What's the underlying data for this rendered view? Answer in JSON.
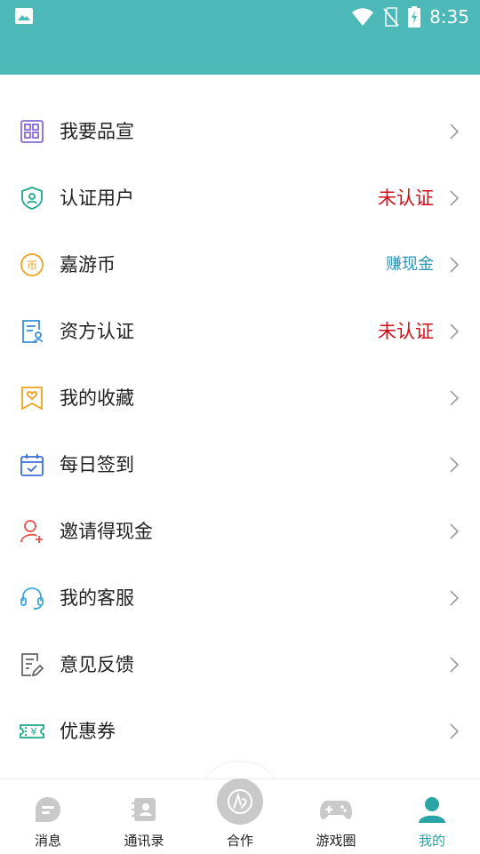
{
  "status_bar": {
    "time": "8:35",
    "icons": [
      "image-icon",
      "wifi-icon",
      "no-sim-icon",
      "battery-charging-icon"
    ]
  },
  "menu": {
    "items": [
      {
        "label": "我要品宣",
        "icon": "grid-apps-icon",
        "status": "",
        "hint": ""
      },
      {
        "label": "认证用户",
        "icon": "shield-user-icon",
        "status": "未认证",
        "hint": ""
      },
      {
        "label": "嘉游币",
        "icon": "coin-icon",
        "status": "",
        "hint": "赚现金"
      },
      {
        "label": "资方认证",
        "icon": "certificate-icon",
        "status": "未认证",
        "hint": ""
      },
      {
        "label": "我的收藏",
        "icon": "heart-bookmark-icon",
        "status": "",
        "hint": ""
      },
      {
        "label": "每日签到",
        "icon": "calendar-check-icon",
        "status": "",
        "hint": ""
      },
      {
        "label": "邀请得现金",
        "icon": "invite-user-icon",
        "status": "",
        "hint": ""
      },
      {
        "label": "我的客服",
        "icon": "headset-icon",
        "status": "",
        "hint": ""
      },
      {
        "label": "意见反馈",
        "icon": "feedback-edit-icon",
        "status": "",
        "hint": ""
      },
      {
        "label": "优惠券",
        "icon": "coupon-icon",
        "status": "",
        "hint": ""
      }
    ]
  },
  "tabbar": {
    "tabs": [
      {
        "label": "消息",
        "icon": "message-icon",
        "active": false
      },
      {
        "label": "通讯录",
        "icon": "contacts-icon",
        "active": false
      },
      {
        "label": "合作",
        "icon": "cooperation-icon",
        "active": false
      },
      {
        "label": "游戏圈",
        "icon": "gamepad-icon",
        "active": false
      },
      {
        "label": "我的",
        "icon": "profile-icon",
        "active": true
      }
    ]
  },
  "colors": {
    "header": "#4db8b8",
    "status_red": "#d0101a",
    "hint_blue": "#2a93b6",
    "active_tab": "#2aa4a6",
    "inactive_tab_icon": "#c9c9c9"
  }
}
